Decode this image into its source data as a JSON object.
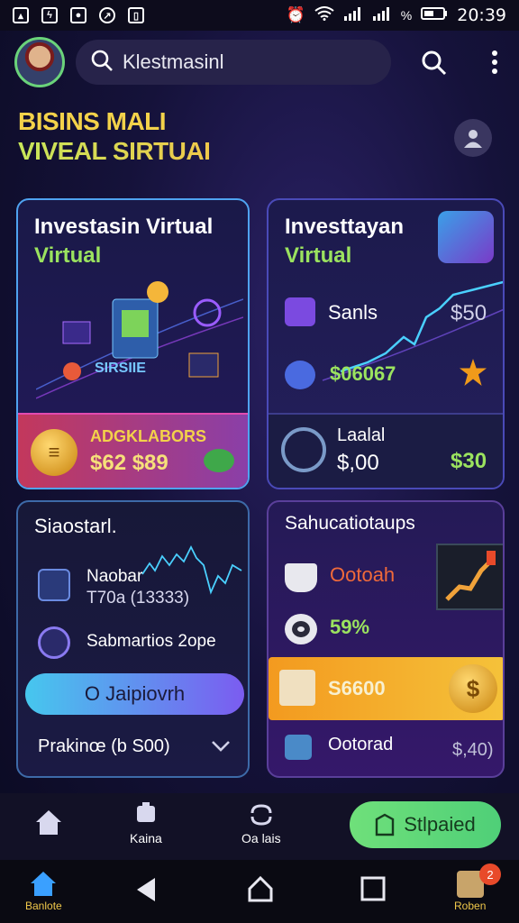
{
  "status": {
    "time": "20:39"
  },
  "search": {
    "text": "Klestmasinl"
  },
  "headline": {
    "line1": "BISINS MALI",
    "line2": "VIVEAL SIRTUAI"
  },
  "card1": {
    "title1": "Investasin Virtual",
    "title2": "Virtual",
    "art_label": "SIRSIIE",
    "promo_label": "ADGKLABORS",
    "promo_value": "$62 $89"
  },
  "card2": {
    "title1": "Investtayan",
    "title2": "Virtual",
    "row1_label": "Sanls",
    "row1_value": "$50",
    "row2_value": "$06067",
    "bottom_label": "Laalal",
    "bottom_value": "$,00",
    "bottom_right": "$30"
  },
  "card3": {
    "title": "Siaostarl.",
    "row1_label": "Naobar",
    "row1_sub": "T70a (13333)",
    "row2_label": "Sabmartios 2ope",
    "button_label": "O Jaipiovrh",
    "footer_label": "Prakinœ (b S00)"
  },
  "card4": {
    "title": "Sahucatiotaups",
    "row1_label": "Ootoah",
    "row2_label": "59%",
    "gold_value": "S6600",
    "footer_label": "Ootorad",
    "footer_value": "$,40)"
  },
  "bottom_nav": {
    "item2": "Kaina",
    "item3": "Oa lais",
    "pill": "Stlpaied"
  },
  "system_nav": {
    "left_label": "Banlote",
    "right_label": "Roben",
    "badge": "2"
  },
  "colors": {
    "accent_green": "#9be35f",
    "accent_gold": "#f3d24a",
    "accent_blue": "#4fa3f0"
  }
}
